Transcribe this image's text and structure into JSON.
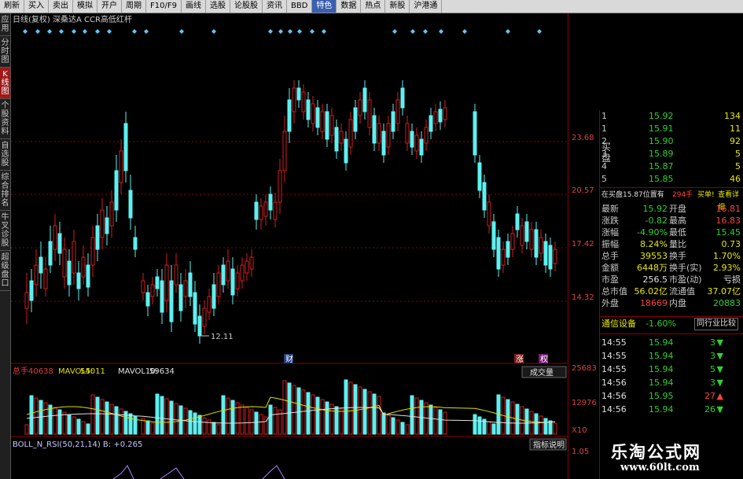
{
  "menubar": [
    "刷新",
    "买入",
    "卖出",
    "模拟",
    "开户",
    "周期",
    "F10/F9",
    "画线",
    "选股",
    "论股股",
    "资讯",
    "BBD",
    "特色",
    "数据",
    "热点",
    "新股",
    "沪港通"
  ],
  "sidebar": [
    "应用",
    "分时图",
    "K线图",
    "个股资料",
    "自选股",
    "综合排名",
    "牛叉诊股",
    "超级盘口"
  ],
  "chart": {
    "header": "日线(复权)  深桑达A  CCR高低红杆",
    "low_label": "12.11",
    "vol_header_label": "总手",
    "vol_value": "40638",
    "mavol5_label": "MAVOL5:",
    "mavol5_value": "54011",
    "mavol10_label": "MAVOL10:",
    "mavol10_value": "59634",
    "vol_dropdown": "成交量",
    "event_cai": "财",
    "event_zhang": "涨",
    "event_quan": "权",
    "ind_header": "BOLL_N_RSI(50,21,14)  B: +0.265",
    "ind_button": "指标说明",
    "price_ticks": [
      "23.68",
      "20.57",
      "17.42",
      "14.32"
    ],
    "vol_ticks": [
      "25683",
      "12976",
      "X10"
    ],
    "ind_tick": "1.05",
    "colors": {
      "up": "#d21e1e",
      "down": "#5ef0f0",
      "grid": "#8a0000"
    }
  },
  "panel": {
    "bids": [
      {
        "label": "1",
        "price": "15.92",
        "vol": "134"
      },
      {
        "label": "1",
        "price": "15.91",
        "vol": "11"
      },
      {
        "label": "2",
        "price": "15.90",
        "vol": "92"
      },
      {
        "label": "3",
        "price": "15.89",
        "vol": "5"
      },
      {
        "label": "4",
        "price": "15.87",
        "vol": "5"
      },
      {
        "label": "5",
        "price": "15.85",
        "vol": "46"
      }
    ],
    "buy_side_label": "买盘",
    "info_bar": {
      "left": "在买盘15.87位置有",
      "qty": "294手",
      "right": "买单!",
      "link": "查看详细"
    },
    "stats": [
      {
        "a": "最新",
        "av": "15.92",
        "b": "开盘",
        "bv": "16.81",
        "ac": "green",
        "bc": "red"
      },
      {
        "a": "涨跌",
        "av": "-0.82",
        "b": "最高",
        "bv": "16.83",
        "ac": "green",
        "bc": "red"
      },
      {
        "a": "涨幅",
        "av": "-4.90%",
        "b": "最低",
        "bv": "15.45",
        "ac": "green",
        "bc": "green"
      },
      {
        "a": "振幅",
        "av": "8.24%",
        "b": "量比",
        "bv": "0.73",
        "ac": "yel",
        "bc": "yel"
      },
      {
        "a": "总手",
        "av": "39553",
        "b": "换手",
        "bv": "1.70%",
        "ac": "yel",
        "bc": "yel"
      },
      {
        "a": "金额",
        "av": "6448万",
        "b": "换手(实)",
        "bv": "2.93%",
        "ac": "yel",
        "bc": "yel"
      },
      {
        "a": "市盈",
        "av": "256.5",
        "b": "市盈(动)",
        "bv": "亏损",
        "ac": "white",
        "bc": "white"
      },
      {
        "a": "总市值",
        "av": "56.02亿",
        "b": "流通值",
        "bv": "37.07亿",
        "ac": "yel",
        "bc": "yel"
      },
      {
        "a": "外盘",
        "av": "18669",
        "b": "内盘",
        "bv": "20883",
        "ac": "red",
        "bc": "green"
      }
    ],
    "sector": {
      "name": "通信设备",
      "chg": "-1.60%",
      "btn": "同行业比较"
    },
    "ticks": [
      {
        "t": "14:55",
        "p": "15.94",
        "v": "3",
        "d": "down"
      },
      {
        "t": "14:55",
        "p": "15.94",
        "v": "3",
        "d": "down"
      },
      {
        "t": "14:55",
        "p": "15.94",
        "v": "5",
        "d": "down"
      },
      {
        "t": "14:56",
        "p": "15.94",
        "v": "3",
        "d": "down"
      },
      {
        "t": "14:56",
        "p": "15.95",
        "v": "27",
        "d": "up"
      },
      {
        "t": "14:56",
        "p": "15.94",
        "v": "26",
        "d": "down"
      }
    ]
  },
  "watermark": {
    "title": "乐淘公式网",
    "url": "www.60lt.com"
  }
}
